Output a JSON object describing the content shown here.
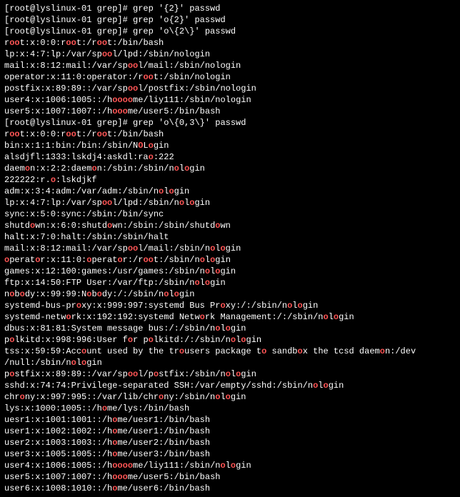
{
  "prompts": [
    {
      "user": "root",
      "host": "lyslinux-01",
      "dir": "grep",
      "cmd": "grep '{2}' passwd"
    },
    {
      "user": "root",
      "host": "lyslinux-01",
      "dir": "grep",
      "cmd": "grep 'o{2}' passwd"
    },
    {
      "user": "root",
      "host": "lyslinux-01",
      "dir": "grep",
      "cmd": "grep 'o\\{2\\}' passwd"
    }
  ],
  "block1": [
    [
      [
        "r",
        0
      ],
      [
        "oo",
        1
      ],
      [
        "t:x:0:0:r",
        0
      ],
      [
        "oo",
        1
      ],
      [
        "t:/r",
        0
      ],
      [
        "oo",
        1
      ],
      [
        "t:/bin/bash",
        0
      ]
    ],
    [
      [
        "lp:x:4:7:lp:/var/sp",
        0
      ],
      [
        "oo",
        1
      ],
      [
        "l/lpd:/sbin/nologin",
        0
      ]
    ],
    [
      [
        "mail:x:8:12:mail:/var/sp",
        0
      ],
      [
        "oo",
        1
      ],
      [
        "l/mail:/sbin/nologin",
        0
      ]
    ],
    [
      [
        "operator:x:11:0:operator:/r",
        0
      ],
      [
        "oo",
        1
      ],
      [
        "t:/sbin/nologin",
        0
      ]
    ],
    [
      [
        "postfix:x:89:89::/var/sp",
        0
      ],
      [
        "oo",
        1
      ],
      [
        "l/postfix:/sbin/nologin",
        0
      ]
    ],
    [
      [
        "user4:x:1006:1005::/h",
        0
      ],
      [
        "oooo",
        1
      ],
      [
        "me/liy111:/sbin/nologin",
        0
      ]
    ],
    [
      [
        "user5:x:1007:1007::/h",
        0
      ],
      [
        "ooo",
        1
      ],
      [
        "me/user5:/bin/bash",
        0
      ]
    ]
  ],
  "prompt2": {
    "user": "root",
    "host": "lyslinux-01",
    "dir": "grep",
    "cmd": "grep 'o\\{0,3\\}' passwd"
  },
  "block2": [
    [
      [
        "r",
        0
      ],
      [
        "oo",
        1
      ],
      [
        "t:x:0:0:r",
        0
      ],
      [
        "oo",
        1
      ],
      [
        "t:/r",
        0
      ],
      [
        "oo",
        1
      ],
      [
        "t:/bin/bash",
        0
      ]
    ],
    [
      [
        "bin:x:1:1:bin:/bin:/sbin/N",
        0
      ],
      [
        "O",
        1
      ],
      [
        "L",
        0
      ],
      [
        "o",
        1
      ],
      [
        "gin",
        0
      ]
    ],
    [
      [
        "alsdjfl:1333:lskdj4:askdl:ra",
        0
      ],
      [
        "o",
        1
      ],
      [
        ":222",
        0
      ]
    ],
    [
      [
        "daem",
        0
      ],
      [
        "o",
        1
      ],
      [
        "n:x:2:2:daem",
        0
      ],
      [
        "o",
        1
      ],
      [
        "n:/sbin:/sbin/n",
        0
      ],
      [
        "o",
        1
      ],
      [
        "l",
        0
      ],
      [
        "o",
        1
      ],
      [
        "gin",
        0
      ]
    ],
    [
      [
        "222222:r.",
        0
      ],
      [
        "o",
        1
      ],
      [
        ":lskdjkf",
        0
      ]
    ],
    [
      [
        "adm:x:3:4:adm:/var/adm:/sbin/n",
        0
      ],
      [
        "o",
        1
      ],
      [
        "l",
        0
      ],
      [
        "o",
        1
      ],
      [
        "gin",
        0
      ]
    ],
    [
      [
        "lp:x:4:7:lp:/var/sp",
        0
      ],
      [
        "oo",
        1
      ],
      [
        "l/lpd:/sbin/n",
        0
      ],
      [
        "o",
        1
      ],
      [
        "l",
        0
      ],
      [
        "o",
        1
      ],
      [
        "gin",
        0
      ]
    ],
    [
      [
        "sync:x:5:0:sync:/sbin:/bin/sync",
        0
      ]
    ],
    [
      [
        "shutd",
        0
      ],
      [
        "o",
        1
      ],
      [
        "wn:x:6:0:shutd",
        0
      ],
      [
        "o",
        1
      ],
      [
        "wn:/sbin:/sbin/shutd",
        0
      ],
      [
        "o",
        1
      ],
      [
        "wn",
        0
      ]
    ],
    [
      [
        "halt:x:7:0:halt:/sbin:/sbin/halt",
        0
      ]
    ],
    [
      [
        "mail:x:8:12:mail:/var/sp",
        0
      ],
      [
        "oo",
        1
      ],
      [
        "l/mail:/sbin/n",
        0
      ],
      [
        "o",
        1
      ],
      [
        "l",
        0
      ],
      [
        "o",
        1
      ],
      [
        "gin",
        0
      ]
    ],
    [
      [
        "",
        0
      ],
      [
        "o",
        1
      ],
      [
        "perat",
        0
      ],
      [
        "o",
        1
      ],
      [
        "r:x:11:0:",
        0
      ],
      [
        "o",
        1
      ],
      [
        "perat",
        0
      ],
      [
        "o",
        1
      ],
      [
        "r:/r",
        0
      ],
      [
        "oo",
        1
      ],
      [
        "t:/sbin/n",
        0
      ],
      [
        "o",
        1
      ],
      [
        "l",
        0
      ],
      [
        "o",
        1
      ],
      [
        "gin",
        0
      ]
    ],
    [
      [
        "games:x:12:100:games:/usr/games:/sbin/n",
        0
      ],
      [
        "o",
        1
      ],
      [
        "l",
        0
      ],
      [
        "o",
        1
      ],
      [
        "gin",
        0
      ]
    ],
    [
      [
        "ftp:x:14:50:FTP User:/var/ftp:/sbin/n",
        0
      ],
      [
        "o",
        1
      ],
      [
        "l",
        0
      ],
      [
        "o",
        1
      ],
      [
        "gin",
        0
      ]
    ],
    [
      [
        "n",
        0
      ],
      [
        "o",
        1
      ],
      [
        "b",
        0
      ],
      [
        "o",
        1
      ],
      [
        "dy:x:99:99:N",
        0
      ],
      [
        "o",
        1
      ],
      [
        "b",
        0
      ],
      [
        "o",
        1
      ],
      [
        "dy:/:/sbin/n",
        0
      ],
      [
        "o",
        1
      ],
      [
        "l",
        0
      ],
      [
        "o",
        1
      ],
      [
        "gin",
        0
      ]
    ],
    [
      [
        "systemd-bus-pr",
        0
      ],
      [
        "o",
        1
      ],
      [
        "xy:x:999:997:systemd Bus Pr",
        0
      ],
      [
        "o",
        1
      ],
      [
        "xy:/:/sbin/n",
        0
      ],
      [
        "o",
        1
      ],
      [
        "l",
        0
      ],
      [
        "o",
        1
      ],
      [
        "gin",
        0
      ]
    ],
    [
      [
        "systemd-netw",
        0
      ],
      [
        "o",
        1
      ],
      [
        "rk:x:192:192:systemd Netw",
        0
      ],
      [
        "o",
        1
      ],
      [
        "rk Management:/:/sbin/n",
        0
      ],
      [
        "o",
        1
      ],
      [
        "l",
        0
      ],
      [
        "o",
        1
      ],
      [
        "gin",
        0
      ]
    ],
    [
      [
        "dbus:x:81:81:System message bus:/:/sbin/n",
        0
      ],
      [
        "o",
        1
      ],
      [
        "l",
        0
      ],
      [
        "o",
        1
      ],
      [
        "gin",
        0
      ]
    ],
    [
      [
        "p",
        0
      ],
      [
        "o",
        1
      ],
      [
        "lkitd:x:998:996:User f",
        0
      ],
      [
        "o",
        1
      ],
      [
        "r p",
        0
      ],
      [
        "o",
        1
      ],
      [
        "lkitd:/:/sbin/n",
        0
      ],
      [
        "o",
        1
      ],
      [
        "l",
        0
      ],
      [
        "o",
        1
      ],
      [
        "gin",
        0
      ]
    ],
    [
      [
        "tss:x:59:59:Acc",
        0
      ],
      [
        "o",
        1
      ],
      [
        "unt used by the tr",
        0
      ],
      [
        "o",
        1
      ],
      [
        "users package t",
        0
      ],
      [
        "o",
        1
      ],
      [
        " sandb",
        0
      ],
      [
        "o",
        1
      ],
      [
        "x the tcsd daem",
        0
      ],
      [
        "o",
        1
      ],
      [
        "n:/dev",
        0
      ]
    ],
    [
      [
        "/null:/sbin/n",
        0
      ],
      [
        "o",
        1
      ],
      [
        "l",
        0
      ],
      [
        "o",
        1
      ],
      [
        "gin",
        0
      ]
    ],
    [
      [
        "p",
        0
      ],
      [
        "o",
        1
      ],
      [
        "stfix:x:89:89::/var/sp",
        0
      ],
      [
        "oo",
        1
      ],
      [
        "l/p",
        0
      ],
      [
        "o",
        1
      ],
      [
        "stfix:/sbin/n",
        0
      ],
      [
        "o",
        1
      ],
      [
        "l",
        0
      ],
      [
        "o",
        1
      ],
      [
        "gin",
        0
      ]
    ],
    [
      [
        "sshd:x:74:74:Privilege-separated SSH:/var/empty/sshd:/sbin/n",
        0
      ],
      [
        "o",
        1
      ],
      [
        "l",
        0
      ],
      [
        "o",
        1
      ],
      [
        "gin",
        0
      ]
    ],
    [
      [
        "chr",
        0
      ],
      [
        "o",
        1
      ],
      [
        "ny:x:997:995::/var/lib/chr",
        0
      ],
      [
        "o",
        1
      ],
      [
        "ny:/sbin/n",
        0
      ],
      [
        "o",
        1
      ],
      [
        "l",
        0
      ],
      [
        "o",
        1
      ],
      [
        "gin",
        0
      ]
    ],
    [
      [
        "lys:x:1000:1005::/h",
        0
      ],
      [
        "o",
        1
      ],
      [
        "me/lys:/bin/bash",
        0
      ]
    ],
    [
      [
        "uesr1:x:1001:1001::/h",
        0
      ],
      [
        "o",
        1
      ],
      [
        "me/uesr1:/bin/bash",
        0
      ]
    ],
    [
      [
        "user1:x:1002:1002::/h",
        0
      ],
      [
        "o",
        1
      ],
      [
        "me/user1:/bin/bash",
        0
      ]
    ],
    [
      [
        "user2:x:1003:1003::/h",
        0
      ],
      [
        "o",
        1
      ],
      [
        "me/user2:/bin/bash",
        0
      ]
    ],
    [
      [
        "user3:x:1005:1005::/h",
        0
      ],
      [
        "o",
        1
      ],
      [
        "me/user3:/bin/bash",
        0
      ]
    ],
    [
      [
        "user4:x:1006:1005::/h",
        0
      ],
      [
        "ooo",
        1
      ],
      [
        "",
        0
      ],
      [
        "o",
        1
      ],
      [
        "me/liy111:/sbin/n",
        0
      ],
      [
        "o",
        1
      ],
      [
        "l",
        0
      ],
      [
        "o",
        1
      ],
      [
        "gin",
        0
      ]
    ],
    [
      [
        "user5:x:1007:1007::/h",
        0
      ],
      [
        "ooo",
        1
      ],
      [
        "me/user5:/bin/bash",
        0
      ]
    ],
    [
      [
        "user6:x:1008:1010::/h",
        0
      ],
      [
        "o",
        1
      ],
      [
        "me/user6:/bin/bash",
        0
      ]
    ]
  ]
}
